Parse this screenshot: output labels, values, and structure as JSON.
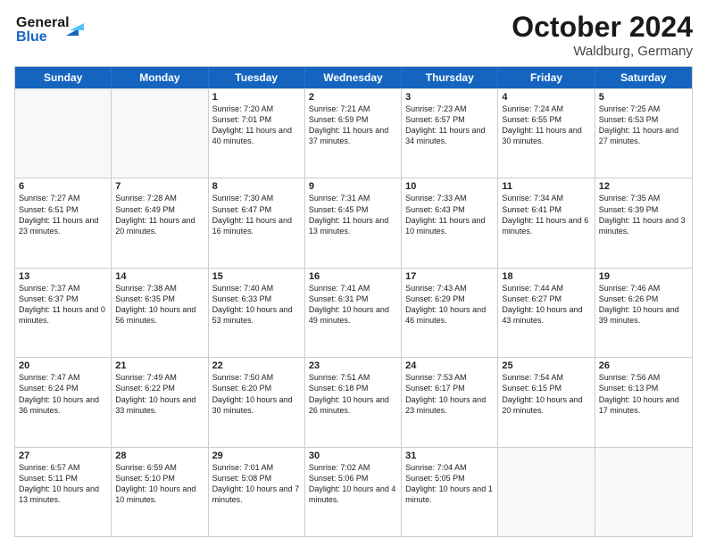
{
  "header": {
    "logo_line1": "General",
    "logo_line2": "Blue",
    "title": "October 2024",
    "location": "Waldburg, Germany"
  },
  "days_of_week": [
    "Sunday",
    "Monday",
    "Tuesday",
    "Wednesday",
    "Thursday",
    "Friday",
    "Saturday"
  ],
  "weeks": [
    [
      {
        "day": "",
        "content": ""
      },
      {
        "day": "",
        "content": ""
      },
      {
        "day": "1",
        "content": "Sunrise: 7:20 AM\nSunset: 7:01 PM\nDaylight: 11 hours and 40 minutes."
      },
      {
        "day": "2",
        "content": "Sunrise: 7:21 AM\nSunset: 6:59 PM\nDaylight: 11 hours and 37 minutes."
      },
      {
        "day": "3",
        "content": "Sunrise: 7:23 AM\nSunset: 6:57 PM\nDaylight: 11 hours and 34 minutes."
      },
      {
        "day": "4",
        "content": "Sunrise: 7:24 AM\nSunset: 6:55 PM\nDaylight: 11 hours and 30 minutes."
      },
      {
        "day": "5",
        "content": "Sunrise: 7:25 AM\nSunset: 6:53 PM\nDaylight: 11 hours and 27 minutes."
      }
    ],
    [
      {
        "day": "6",
        "content": "Sunrise: 7:27 AM\nSunset: 6:51 PM\nDaylight: 11 hours and 23 minutes."
      },
      {
        "day": "7",
        "content": "Sunrise: 7:28 AM\nSunset: 6:49 PM\nDaylight: 11 hours and 20 minutes."
      },
      {
        "day": "8",
        "content": "Sunrise: 7:30 AM\nSunset: 6:47 PM\nDaylight: 11 hours and 16 minutes."
      },
      {
        "day": "9",
        "content": "Sunrise: 7:31 AM\nSunset: 6:45 PM\nDaylight: 11 hours and 13 minutes."
      },
      {
        "day": "10",
        "content": "Sunrise: 7:33 AM\nSunset: 6:43 PM\nDaylight: 11 hours and 10 minutes."
      },
      {
        "day": "11",
        "content": "Sunrise: 7:34 AM\nSunset: 6:41 PM\nDaylight: 11 hours and 6 minutes."
      },
      {
        "day": "12",
        "content": "Sunrise: 7:35 AM\nSunset: 6:39 PM\nDaylight: 11 hours and 3 minutes."
      }
    ],
    [
      {
        "day": "13",
        "content": "Sunrise: 7:37 AM\nSunset: 6:37 PM\nDaylight: 11 hours and 0 minutes."
      },
      {
        "day": "14",
        "content": "Sunrise: 7:38 AM\nSunset: 6:35 PM\nDaylight: 10 hours and 56 minutes."
      },
      {
        "day": "15",
        "content": "Sunrise: 7:40 AM\nSunset: 6:33 PM\nDaylight: 10 hours and 53 minutes."
      },
      {
        "day": "16",
        "content": "Sunrise: 7:41 AM\nSunset: 6:31 PM\nDaylight: 10 hours and 49 minutes."
      },
      {
        "day": "17",
        "content": "Sunrise: 7:43 AM\nSunset: 6:29 PM\nDaylight: 10 hours and 46 minutes."
      },
      {
        "day": "18",
        "content": "Sunrise: 7:44 AM\nSunset: 6:27 PM\nDaylight: 10 hours and 43 minutes."
      },
      {
        "day": "19",
        "content": "Sunrise: 7:46 AM\nSunset: 6:26 PM\nDaylight: 10 hours and 39 minutes."
      }
    ],
    [
      {
        "day": "20",
        "content": "Sunrise: 7:47 AM\nSunset: 6:24 PM\nDaylight: 10 hours and 36 minutes."
      },
      {
        "day": "21",
        "content": "Sunrise: 7:49 AM\nSunset: 6:22 PM\nDaylight: 10 hours and 33 minutes."
      },
      {
        "day": "22",
        "content": "Sunrise: 7:50 AM\nSunset: 6:20 PM\nDaylight: 10 hours and 30 minutes."
      },
      {
        "day": "23",
        "content": "Sunrise: 7:51 AM\nSunset: 6:18 PM\nDaylight: 10 hours and 26 minutes."
      },
      {
        "day": "24",
        "content": "Sunrise: 7:53 AM\nSunset: 6:17 PM\nDaylight: 10 hours and 23 minutes."
      },
      {
        "day": "25",
        "content": "Sunrise: 7:54 AM\nSunset: 6:15 PM\nDaylight: 10 hours and 20 minutes."
      },
      {
        "day": "26",
        "content": "Sunrise: 7:56 AM\nSunset: 6:13 PM\nDaylight: 10 hours and 17 minutes."
      }
    ],
    [
      {
        "day": "27",
        "content": "Sunrise: 6:57 AM\nSunset: 5:11 PM\nDaylight: 10 hours and 13 minutes."
      },
      {
        "day": "28",
        "content": "Sunrise: 6:59 AM\nSunset: 5:10 PM\nDaylight: 10 hours and 10 minutes."
      },
      {
        "day": "29",
        "content": "Sunrise: 7:01 AM\nSunset: 5:08 PM\nDaylight: 10 hours and 7 minutes."
      },
      {
        "day": "30",
        "content": "Sunrise: 7:02 AM\nSunset: 5:06 PM\nDaylight: 10 hours and 4 minutes."
      },
      {
        "day": "31",
        "content": "Sunrise: 7:04 AM\nSunset: 5:05 PM\nDaylight: 10 hours and 1 minute."
      },
      {
        "day": "",
        "content": ""
      },
      {
        "day": "",
        "content": ""
      }
    ]
  ]
}
